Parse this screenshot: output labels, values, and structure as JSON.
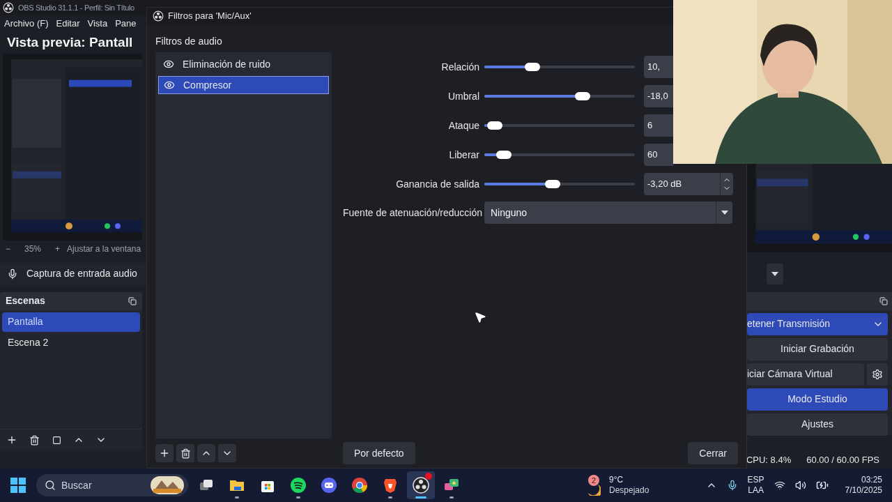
{
  "main_window": {
    "title": "OBS Studio 31.1.1 - Perfil: Sin Título",
    "menu": [
      "Archivo (F)",
      "Editar",
      "Vista",
      "Pane"
    ],
    "preview_title": "Vista previa: Pantall",
    "zoom_bar": {
      "minus": "−",
      "zoom": "35%",
      "plus": "+",
      "fit": "Ajustar a la ventana"
    },
    "source_bar": {
      "label": "Captura de entrada audio"
    },
    "scenes": {
      "title": "Escenas",
      "items": [
        {
          "label": "Pantalla",
          "selected": true
        },
        {
          "label": "Escena 2",
          "selected": false
        }
      ]
    },
    "controls": {
      "buttons": [
        {
          "label": "etener Transmisión",
          "kind": "menu",
          "active": true
        },
        {
          "label": "Iniciar Grabación",
          "kind": "plain",
          "active": false
        },
        {
          "label": "iciar Cámara Virtual",
          "kind": "settings",
          "active": false
        },
        {
          "label": "Modo Estudio",
          "kind": "plain",
          "active": true
        },
        {
          "label": "Ajustes",
          "kind": "plain",
          "active": false
        }
      ]
    },
    "status_bar": {
      "cpu": "CPU: 8.4%",
      "fps": "60.00 / 60.00 FPS"
    }
  },
  "dialog": {
    "title": "Filtros para 'Mic/Aux'",
    "section": "Filtros de audio",
    "filters": [
      {
        "name": "Eliminación de ruido",
        "selected": false
      },
      {
        "name": "Compresor",
        "selected": true
      }
    ],
    "properties": [
      {
        "kind": "slider",
        "label": "Relación",
        "level": 0.3,
        "value": "10,",
        "stepper": false
      },
      {
        "kind": "slider",
        "label": "Umbral",
        "level": 0.67,
        "value": "-18,0",
        "stepper": false
      },
      {
        "kind": "slider",
        "label": "Ataque",
        "level": 0.02,
        "value": "6",
        "stepper": false
      },
      {
        "kind": "slider",
        "label": "Liberar",
        "level": 0.09,
        "value": "60",
        "stepper": false
      },
      {
        "kind": "slider",
        "label": "Ganancia de salida",
        "level": 0.45,
        "value": "-3,20 dB",
        "stepper": true
      },
      {
        "kind": "select",
        "label": "Fuente de atenuación/reducción",
        "value": "Ninguno"
      }
    ],
    "buttons": {
      "defaults": "Por defecto",
      "close": "Cerrar"
    }
  },
  "taskbar": {
    "search_placeholder": "Buscar",
    "apps": [
      {
        "kind": "taskview",
        "running": false,
        "active": false
      },
      {
        "kind": "folder",
        "running": true,
        "active": false
      },
      {
        "kind": "store",
        "running": false,
        "active": false
      },
      {
        "kind": "spotify",
        "running": true,
        "active": false
      },
      {
        "kind": "discord",
        "running": false,
        "active": false
      },
      {
        "kind": "chrome",
        "running": false,
        "active": false
      },
      {
        "kind": "brave",
        "running": true,
        "active": false
      },
      {
        "kind": "obs",
        "running": true,
        "active": true
      },
      {
        "kind": "chat",
        "running": true,
        "active": false
      }
    ],
    "weather": {
      "badge": "2",
      "temperature": "9°C",
      "condition": "Despejado"
    },
    "language": {
      "code": "ESP",
      "layout": "LAA"
    },
    "clock": {
      "time": "03:25",
      "date": "7/10/2025"
    }
  }
}
